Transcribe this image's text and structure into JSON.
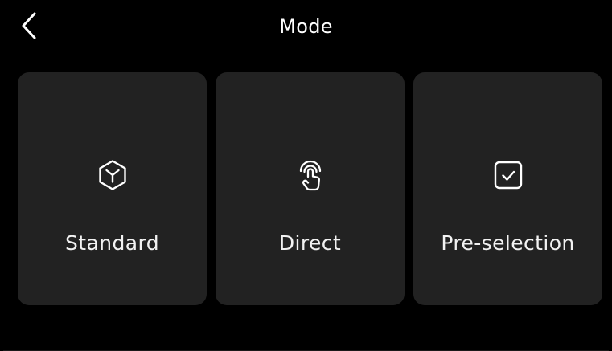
{
  "header": {
    "title": "Mode",
    "back_icon": "chevron-left-icon"
  },
  "modes": [
    {
      "label": "Standard",
      "icon": "cube-icon"
    },
    {
      "label": "Direct",
      "icon": "touch-tap-icon"
    },
    {
      "label": "Pre-selection",
      "icon": "checkbox-icon"
    }
  ],
  "colors": {
    "background": "#000000",
    "card": "#222222",
    "text": "#ffffff"
  }
}
